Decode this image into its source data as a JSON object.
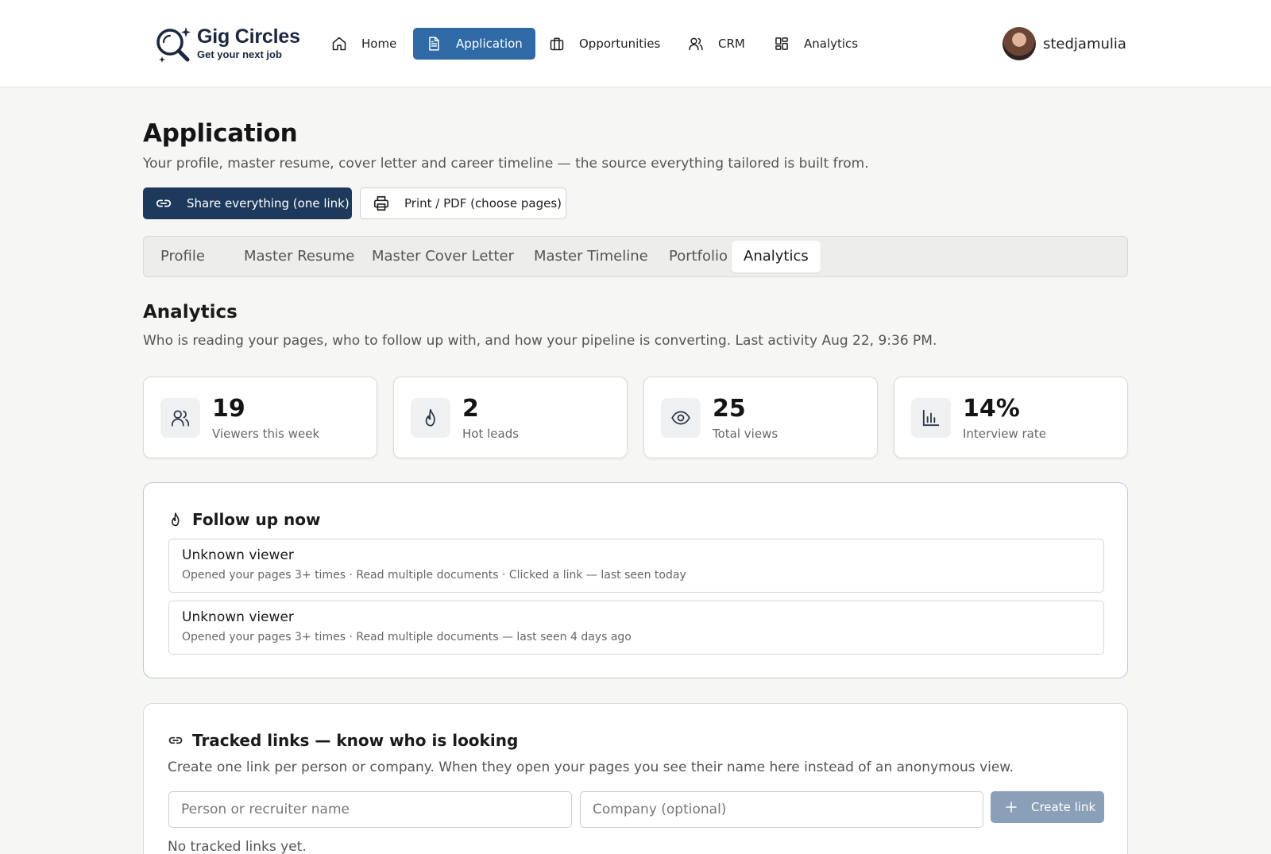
{
  "brand": {
    "name": "Gig Circles",
    "tagline": "Get your next job",
    "primary_color": "#1d3a5c",
    "accent_color": "#2f6aa6"
  },
  "nav": {
    "items": [
      {
        "label": "Home",
        "icon": "home-icon",
        "active": false
      },
      {
        "label": "Application",
        "icon": "document-icon",
        "active": true
      },
      {
        "label": "Opportunities",
        "icon": "briefcase-icon",
        "active": false
      },
      {
        "label": "CRM",
        "icon": "users-icon",
        "active": false
      },
      {
        "label": "Analytics",
        "icon": "grid-icon",
        "active": false
      }
    ]
  },
  "user": {
    "username": "stedjamulia"
  },
  "page": {
    "title": "Application",
    "subtitle": "Your profile, master resume, cover letter and career timeline — the source everything tailored is built from.",
    "share_button": "Share everything (one link)",
    "print_button": "Print / PDF (choose pages)"
  },
  "tabs": [
    {
      "label": "Profile",
      "active": false
    },
    {
      "label": "Master Resume",
      "active": false
    },
    {
      "label": "Master Cover Letter",
      "active": false
    },
    {
      "label": "Master Timeline",
      "active": false
    },
    {
      "label": "Portfolio",
      "active": false
    },
    {
      "label": "Analytics",
      "active": true
    }
  ],
  "analytics": {
    "title": "Analytics",
    "description": "Who is reading your pages, who to follow up with, and how your pipeline is converting. Last activity Aug 22, 9:36 PM.",
    "stats": [
      {
        "value": "19",
        "label": "Viewers this week",
        "icon": "users-icon"
      },
      {
        "value": "2",
        "label": "Hot leads",
        "icon": "flame-icon"
      },
      {
        "value": "25",
        "label": "Total views",
        "icon": "eye-icon"
      },
      {
        "value": "14%",
        "label": "Interview rate",
        "icon": "bar-chart-icon"
      }
    ]
  },
  "follow_up": {
    "title": "Follow up now",
    "viewers": [
      {
        "name": "Unknown viewer",
        "details": "Opened your pages 3+ times · Read multiple documents · Clicked a link — last seen today"
      },
      {
        "name": "Unknown viewer",
        "details": "Opened your pages 3+ times · Read multiple documents — last seen 4 days ago"
      }
    ]
  },
  "tracked_links": {
    "title": "Tracked links — know who is looking",
    "description": "Create one link per person or company. When they open your pages you see their name here instead of an anonymous view.",
    "name_placeholder": "Person or recruiter name",
    "company_placeholder": "Company (optional)",
    "create_button": "Create link",
    "empty_message": "No tracked links yet."
  }
}
